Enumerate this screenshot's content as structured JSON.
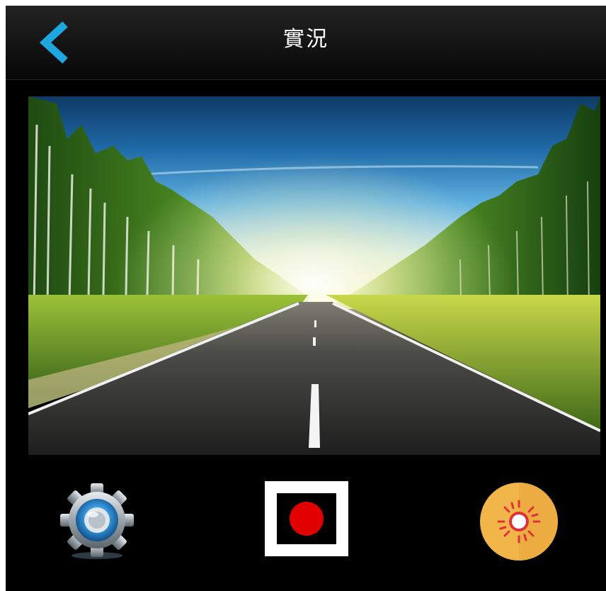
{
  "header": {
    "title": "實況",
    "back_icon": "chevron-left-icon",
    "back_color": "#1da7e0"
  },
  "live_view": {
    "content": "camera-preview-road-forest"
  },
  "controls": {
    "settings_icon": "gear-icon",
    "record_icon": "record-icon",
    "brightness_icon": "sun-icon",
    "record_color": "#e00000",
    "brightness_color": "#f2b54a"
  }
}
